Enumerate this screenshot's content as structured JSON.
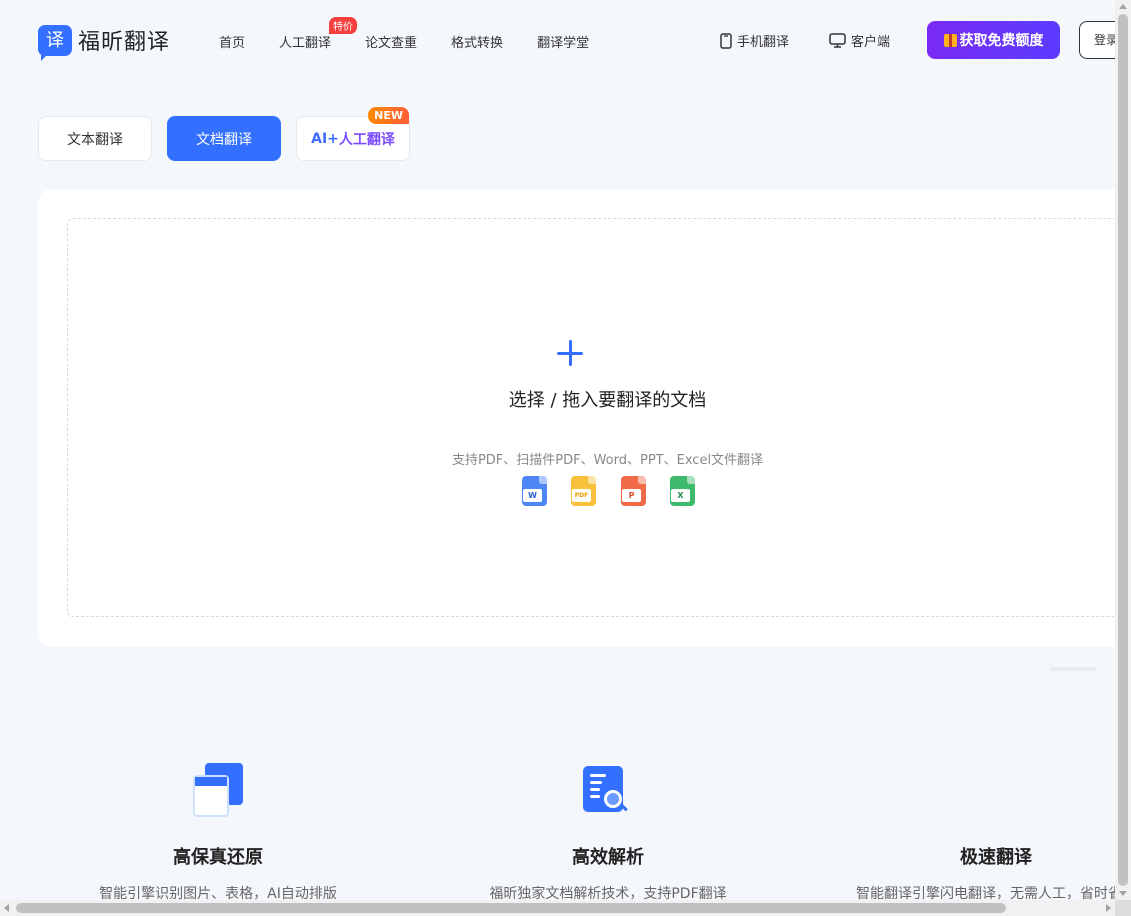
{
  "brand": {
    "logo_char": "译",
    "name": "福昕翻译"
  },
  "nav": {
    "items": [
      "首页",
      "人工翻译",
      "论文查重",
      "格式转换",
      "翻译学堂"
    ],
    "hot_badge": "特价"
  },
  "header_links": {
    "mobile": "手机翻译",
    "desktop": "客户端"
  },
  "cta_label": "获取免费额度",
  "login_label": "登录",
  "tabs": {
    "text": "文本翻译",
    "doc": "文档翻译",
    "ai_prefix": "AI+",
    "ai_suffix": "人工翻译",
    "new_badge": "NEW"
  },
  "upload": {
    "title": "选择 / 拖入要翻译的文档",
    "subtitle": "支持PDF、扫描件PDF、Word、PPT、Excel文件翻译",
    "file_types": [
      "W",
      "PDF",
      "P",
      "X"
    ]
  },
  "features": [
    {
      "title": "高保真还原",
      "desc": "智能引擎识别图片、表格，AI自动排版"
    },
    {
      "title": "高效解析",
      "desc": "福昕独家文档解析技术，支持PDF翻译"
    },
    {
      "title": "极速翻译",
      "desc": "智能翻译引擎闪电翻译，无需人工，省时省力"
    }
  ],
  "colors": {
    "primary": "#3370ff",
    "cta_start": "#7a2cf4",
    "cta_end": "#5b3bff",
    "hot": "#f53f3f",
    "new_badge": "#ff8a00"
  }
}
